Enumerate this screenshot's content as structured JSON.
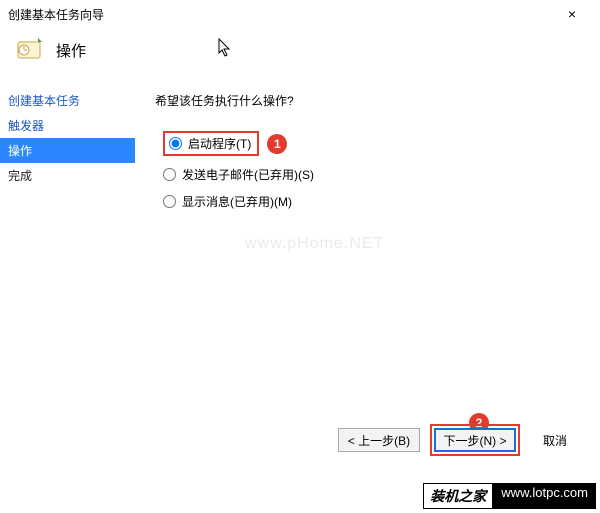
{
  "window": {
    "title": "创建基本任务向导",
    "close_glyph": "×"
  },
  "header": {
    "title": "操作"
  },
  "sidebar": {
    "items": [
      {
        "label": "创建基本任务"
      },
      {
        "label": "触发器"
      },
      {
        "label": "操作"
      },
      {
        "label": "完成"
      }
    ],
    "selected_index": 2
  },
  "main": {
    "prompt": "希望该任务执行什么操作?",
    "options": [
      {
        "label": "启动程序(T)",
        "value": "start_program"
      },
      {
        "label": "发送电子邮件(已弃用)(S)",
        "value": "send_email"
      },
      {
        "label": "显示消息(已弃用)(M)",
        "value": "show_message"
      }
    ],
    "selected_value": "start_program"
  },
  "footer": {
    "back": "< 上一步(B)",
    "next": "下一步(N) >",
    "cancel": "取消"
  },
  "annotations": {
    "opt1": "1",
    "next": "2"
  },
  "watermark": {
    "text": "www.pHome.NET",
    "site1": "装机之家",
    "site2": "www.lotpc.com"
  }
}
